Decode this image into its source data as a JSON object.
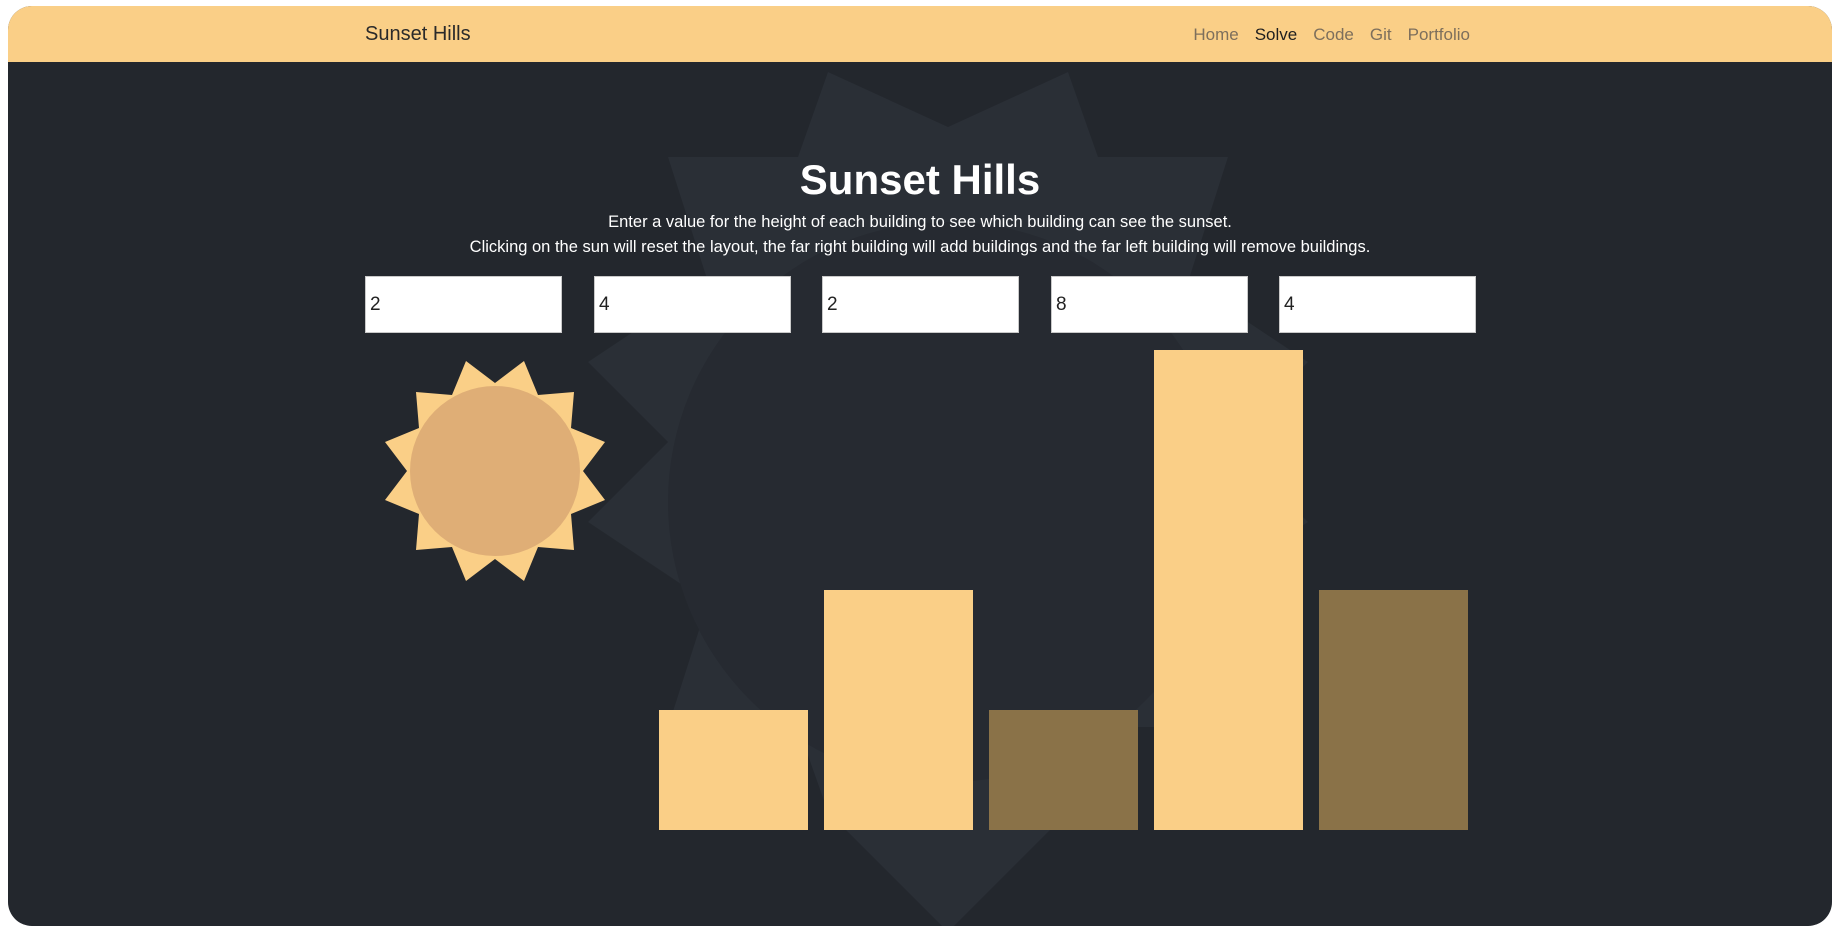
{
  "navbar": {
    "brand": "Sunset Hills",
    "links": [
      {
        "label": "Home",
        "active": false
      },
      {
        "label": "Solve",
        "active": true
      },
      {
        "label": "Code",
        "active": false
      },
      {
        "label": "Git",
        "active": false
      },
      {
        "label": "Portfolio",
        "active": false
      }
    ]
  },
  "main": {
    "title": "Sunset Hills",
    "description_line1": "Enter a value for the height of each building to see which building can see the sunset.",
    "description_line2": "Clicking on the sun will reset the layout, the far right building will add buildings and the far left building will remove buildings."
  },
  "inputs": [
    "2",
    "4",
    "2",
    "8",
    "4"
  ],
  "buildings": [
    {
      "height": 2,
      "sees_sunset": true
    },
    {
      "height": 4,
      "sees_sunset": true
    },
    {
      "height": 2,
      "sees_sunset": false
    },
    {
      "height": 8,
      "sees_sunset": true
    },
    {
      "height": 4,
      "sees_sunset": false
    }
  ],
  "colors": {
    "accent": "#facf87",
    "shadow_building": "#8a7248",
    "background": "#23272d",
    "sun_core": "#dfae76"
  }
}
